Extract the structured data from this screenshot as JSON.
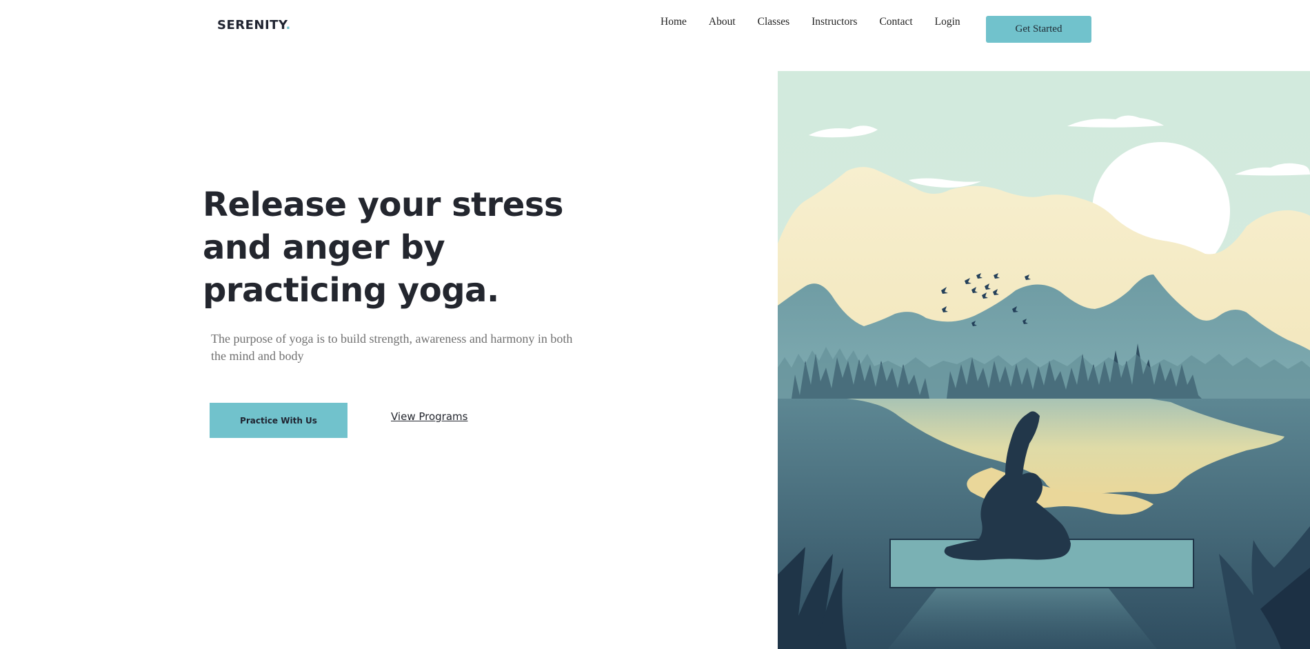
{
  "brand": {
    "name": "SERENITY",
    "dot": "."
  },
  "nav": {
    "items": [
      "Home",
      "About",
      "Classes",
      "Instructors",
      "Contact",
      "Login"
    ],
    "cta": "Get Started"
  },
  "hero": {
    "title": "Release your stress and anger by practicing yoga.",
    "subtitle": "The purpose of yoga is to build strength, awareness and harmony in both the mind and body",
    "primary_cta": "Practice With Us",
    "secondary_cta": "View Programs"
  },
  "colors": {
    "accent": "#71c2cc",
    "text_dark": "#23262e",
    "text_muted": "#707070"
  }
}
